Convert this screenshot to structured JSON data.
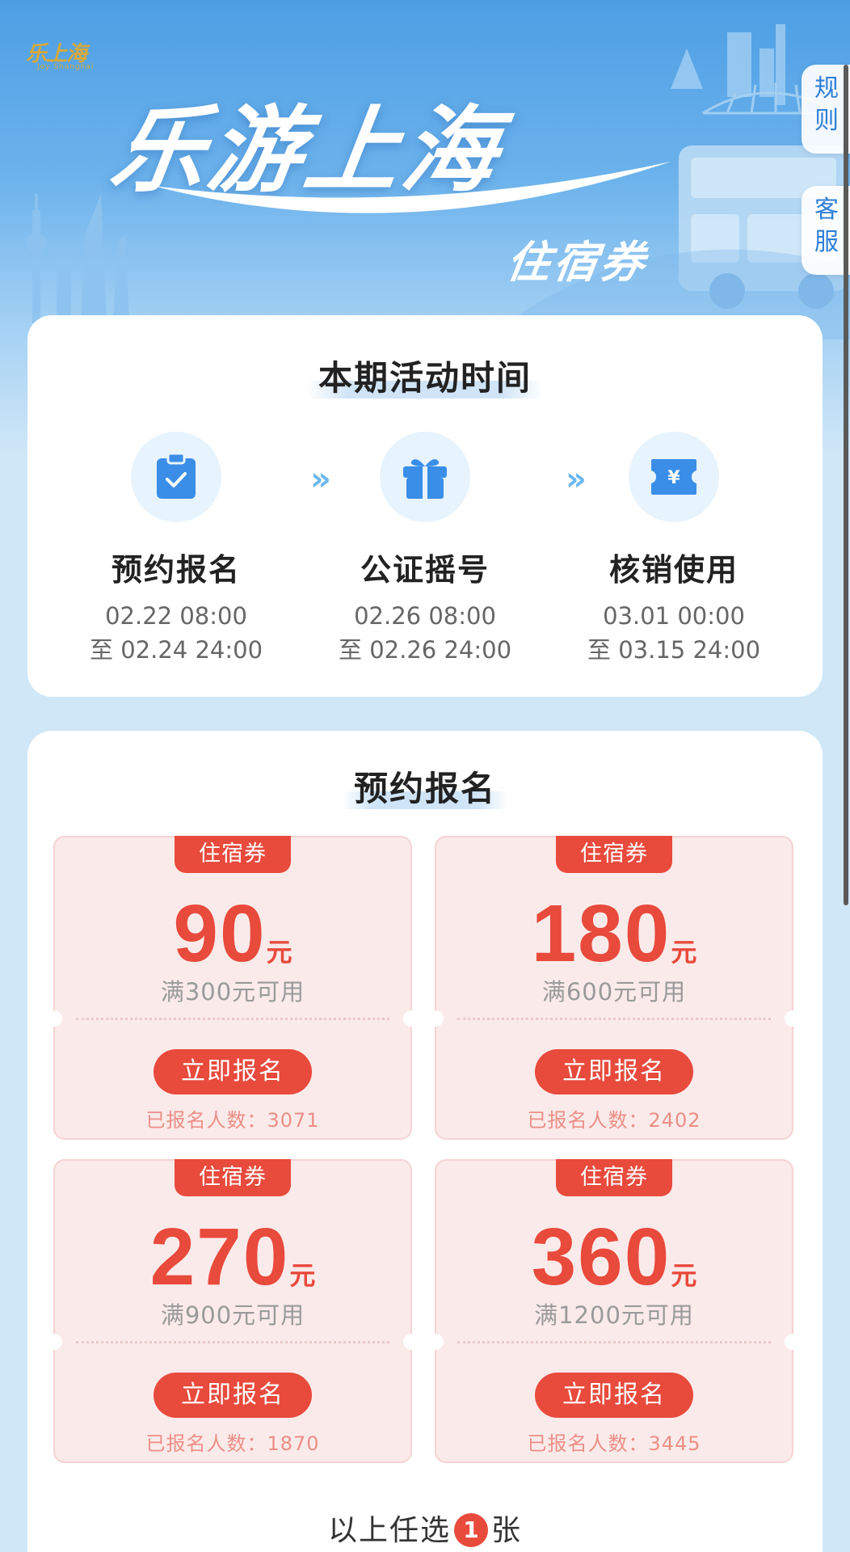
{
  "banner": {
    "small_logo": "乐上海",
    "small_logo_sub": "Joy Shanghai",
    "title": "乐游上海",
    "subtitle": "住宿券",
    "rules_tab": [
      "规",
      "则"
    ],
    "service_tab": [
      "客",
      "服"
    ]
  },
  "schedule": {
    "title": "本期活动时间",
    "steps": [
      {
        "label": "预约报名",
        "icon": "clipboard-check-icon",
        "start": "02.22 08:00",
        "end": "至 02.24 24:00"
      },
      {
        "label": "公证摇号",
        "icon": "gift-icon",
        "start": "02.26 08:00",
        "end": "至 02.26 24:00"
      },
      {
        "label": "核销使用",
        "icon": "yuan-ticket-icon",
        "start": "03.01 00:00",
        "end": "至 03.15 24:00"
      }
    ],
    "separator": "»"
  },
  "signup": {
    "title": "预约报名",
    "vouchers": [
      {
        "tag": "住宿券",
        "amount": "90",
        "unit": "元",
        "condition": "满300元可用",
        "button": "立即报名",
        "count": "已报名人数：3071"
      },
      {
        "tag": "住宿券",
        "amount": "180",
        "unit": "元",
        "condition": "满600元可用",
        "button": "立即报名",
        "count": "已报名人数：2402"
      },
      {
        "tag": "住宿券",
        "amount": "270",
        "unit": "元",
        "condition": "满900元可用",
        "button": "立即报名",
        "count": "已报名人数：1870"
      },
      {
        "tag": "住宿券",
        "amount": "360",
        "unit": "元",
        "condition": "满1200元可用",
        "button": "立即报名",
        "count": "已报名人数：3445"
      }
    ],
    "footer_prefix": "以上任选",
    "footer_count": "1",
    "footer_suffix": "张"
  },
  "colors": {
    "accent_red": "#e84a3c",
    "brand_blue": "#2f7fd8",
    "banner_blue": "#4d9ee4"
  }
}
